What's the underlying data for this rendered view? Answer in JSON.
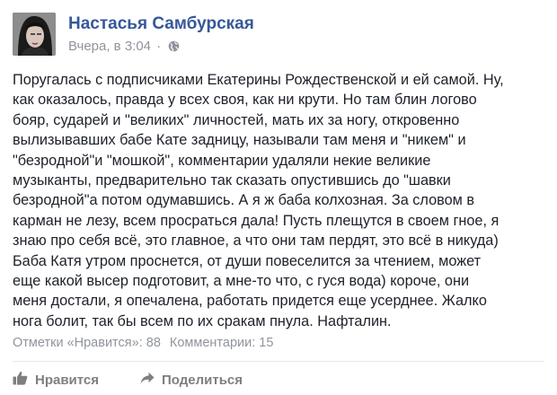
{
  "post": {
    "author": "Настасья Самбурская",
    "time": "Вчера, в 3:04",
    "separator": "·",
    "privacy_icon": "globe-icon",
    "text_lines": [
      "Поругалась с подписчиками Екатерины Рождественской и ей самой. Ну,",
      "как оказалось, правда у всех своя, как ни крути. Но там блин логово",
      "бояр, сударей и \"великих\" личностей, мать их за ногу, откровенно",
      "вылизывавших бабе Кате задницу, называли там меня и \"никем\" и",
      "\"безродной\"и \"мошкой\", комментарии удаляли некие великие",
      "музыканты, предварительно так сказать опустившись до \"шавки",
      "безродной\"а потом одумавшись. А я ж баба колхозная. За словом в",
      "карман не лезу, всем просраться дала! Пусть плещутся в своем гное, я",
      "знаю про себя всё, это главное, а что они там пердят, это всё в никуда)",
      "Баба Катя утром проснется, от души повеселится за чтением, может",
      "еще какой высер подготовит, а мне-то что, с гуся вода) короче, они",
      "меня достали, я опечалена, работать придется еще усерднее. Жалко",
      "нога болит, так бы всем по их сракам пнула. Нафталин."
    ],
    "likes_text": "Отметки «Нравится»: 88",
    "comments_text": "Комментарии: 15"
  },
  "actions": {
    "like_label": "Нравится",
    "like_icon": "thumbs-up-icon",
    "share_label": "Поделиться",
    "share_icon": "share-arrow-icon"
  },
  "colors": {
    "author_link": "#365899",
    "meta_gray": "#90949c",
    "body_text": "#1d2129",
    "action_gray": "#7f7f7f"
  }
}
